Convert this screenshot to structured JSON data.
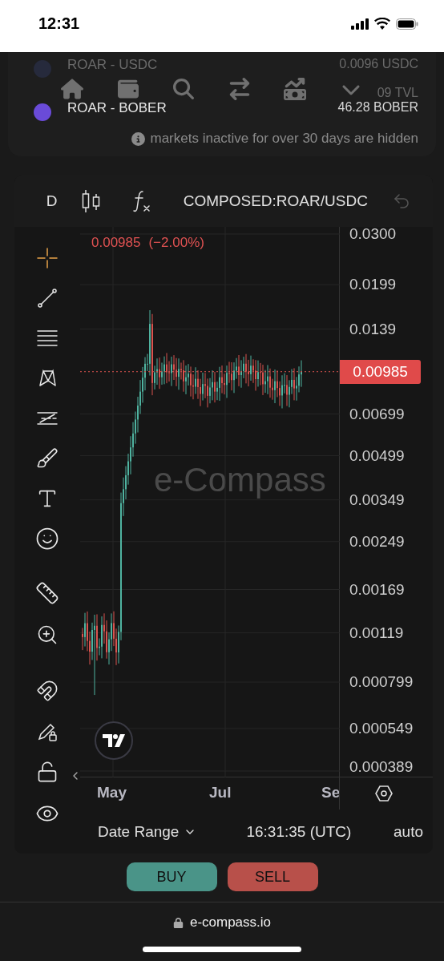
{
  "status_bar": {
    "time": "12:31"
  },
  "markets": [
    {
      "pair": "ROAR - USDC",
      "price": "0.0096 USDC",
      "tvl": "09 TVL",
      "faded": true
    },
    {
      "pair": "ROAR - BOBER",
      "price": "46.28 BOBER",
      "faded": false
    }
  ],
  "markets_note": "markets inactive for over 30 days are hidden",
  "chart": {
    "interval": "D",
    "symbol": "COMPOSED:ROAR/USDC",
    "legend": {
      "price": "0.00985",
      "change": "(−2.00%)"
    },
    "watermark": "e-Compass",
    "last_price": "0.00985",
    "price_labels": [
      "0.0300",
      "0.0199",
      "0.0139",
      "0.00699",
      "0.00499",
      "0.00349",
      "0.00249",
      "0.00169",
      "0.00119",
      "0.000799",
      "0.000549",
      "0.000389"
    ],
    "time_labels": [
      "May",
      "Jul",
      "Se"
    ]
  },
  "footer": {
    "date_range": "Date Range",
    "time": "16:31:35 (UTC)",
    "scale": "auto"
  },
  "actions": [
    {
      "label": "BUY",
      "kind": "buy"
    },
    {
      "label": "SELL",
      "kind": "sell"
    }
  ],
  "browser": {
    "url": "e-compass.io"
  }
}
